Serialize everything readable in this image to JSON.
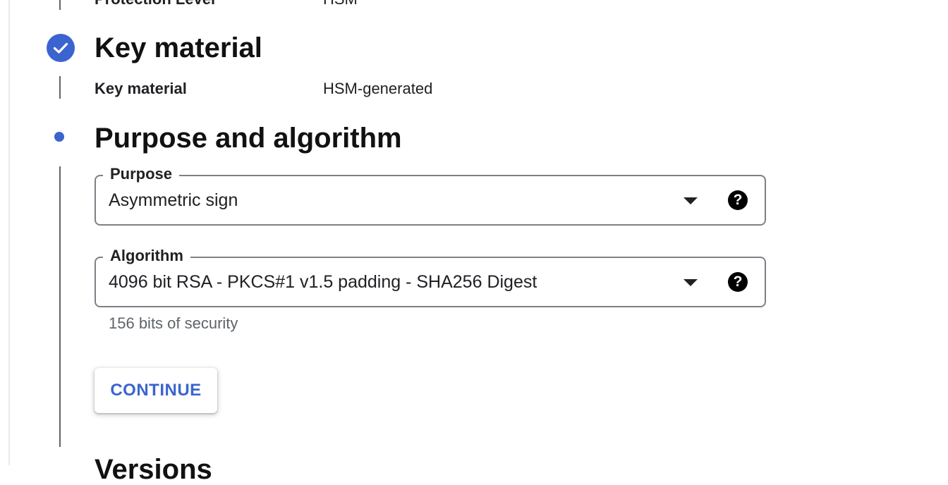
{
  "summary_prev": {
    "label": "Protection Level",
    "value": "HSM"
  },
  "steps": {
    "key_material": {
      "title": "Key material",
      "summary_label": "Key material",
      "summary_value": "HSM-generated",
      "status_icon": "check-circle-icon"
    },
    "purpose_algorithm": {
      "title": "Purpose and algorithm",
      "status_icon": "active-step-dot",
      "purpose": {
        "label": "Purpose",
        "value": "Asymmetric sign"
      },
      "algorithm": {
        "label": "Algorithm",
        "value": "4096 bit RSA - PKCS#1 v1.5 padding - SHA256 Digest",
        "hint": "156 bits of security"
      },
      "continue_label": "CONTINUE"
    },
    "next": {
      "title": "Versions"
    }
  },
  "colors": {
    "accent": "#3b64d0",
    "border": "#7d8086",
    "muted_text": "#5f6368"
  }
}
